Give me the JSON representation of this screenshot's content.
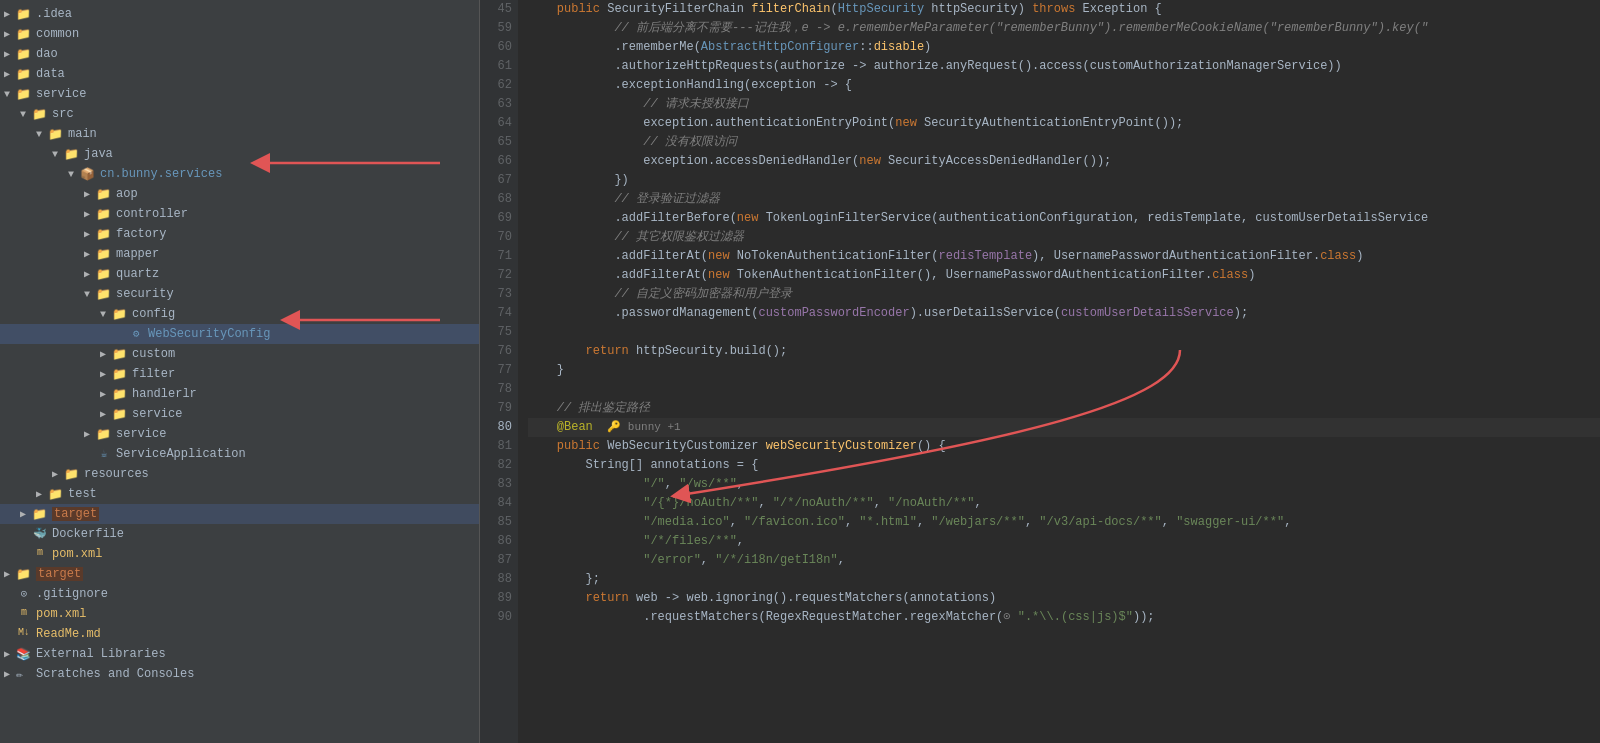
{
  "sidebar": {
    "items": [
      {
        "id": "idea",
        "label": ".idea",
        "level": 0,
        "type": "folder",
        "expanded": false,
        "arrow": "▶"
      },
      {
        "id": "common",
        "label": "common",
        "level": 0,
        "type": "folder",
        "expanded": false,
        "arrow": "▶"
      },
      {
        "id": "dao",
        "label": "dao",
        "level": 0,
        "type": "folder",
        "expanded": false,
        "arrow": "▶"
      },
      {
        "id": "data",
        "label": "data",
        "level": 0,
        "type": "folder",
        "expanded": false,
        "arrow": "▶"
      },
      {
        "id": "service",
        "label": "service",
        "level": 0,
        "type": "folder",
        "expanded": true,
        "arrow": "▼"
      },
      {
        "id": "src",
        "label": "src",
        "level": 1,
        "type": "folder",
        "expanded": true,
        "arrow": "▼"
      },
      {
        "id": "main",
        "label": "main",
        "level": 2,
        "type": "folder",
        "expanded": true,
        "arrow": "▼"
      },
      {
        "id": "java",
        "label": "java",
        "level": 3,
        "type": "folder-src",
        "expanded": true,
        "arrow": "▼"
      },
      {
        "id": "cn.bunny.services",
        "label": "cn.bunny.services",
        "level": 4,
        "type": "folder-pkg",
        "expanded": true,
        "arrow": "▼"
      },
      {
        "id": "aop",
        "label": "aop",
        "level": 5,
        "type": "folder",
        "expanded": false,
        "arrow": "▶"
      },
      {
        "id": "controller",
        "label": "controller",
        "level": 5,
        "type": "folder",
        "expanded": false,
        "arrow": "▶"
      },
      {
        "id": "factory",
        "label": "factory",
        "level": 5,
        "type": "folder",
        "expanded": false,
        "arrow": "▶"
      },
      {
        "id": "mapper",
        "label": "mapper",
        "level": 5,
        "type": "folder",
        "expanded": false,
        "arrow": "▶"
      },
      {
        "id": "quartz",
        "label": "quartz",
        "level": 5,
        "type": "folder",
        "expanded": false,
        "arrow": "▶"
      },
      {
        "id": "security",
        "label": "security",
        "level": 5,
        "type": "folder",
        "expanded": true,
        "arrow": "▼"
      },
      {
        "id": "config",
        "label": "config",
        "level": 6,
        "type": "folder",
        "expanded": true,
        "arrow": "▼"
      },
      {
        "id": "WebSecurityConfig",
        "label": "WebSecurityConfig",
        "level": 7,
        "type": "java-config",
        "arrow": ""
      },
      {
        "id": "custom",
        "label": "custom",
        "level": 6,
        "type": "folder",
        "expanded": false,
        "arrow": "▶"
      },
      {
        "id": "filter",
        "label": "filter",
        "level": 6,
        "type": "folder",
        "expanded": false,
        "arrow": "▶"
      },
      {
        "id": "handlerr",
        "label": "handlerr",
        "level": 6,
        "type": "folder",
        "expanded": false,
        "arrow": "▶"
      },
      {
        "id": "service-inner",
        "label": "service",
        "level": 6,
        "type": "folder",
        "expanded": false,
        "arrow": "▶"
      },
      {
        "id": "service2",
        "label": "service",
        "level": 5,
        "type": "folder",
        "expanded": false,
        "arrow": "▶"
      },
      {
        "id": "ServiceApplication",
        "label": "ServiceApplication",
        "level": 5,
        "type": "java-app",
        "arrow": ""
      },
      {
        "id": "resources",
        "label": "resources",
        "level": 3,
        "type": "folder",
        "expanded": false,
        "arrow": "▶"
      },
      {
        "id": "test",
        "label": "test",
        "level": 2,
        "type": "folder",
        "expanded": false,
        "arrow": "▶"
      },
      {
        "id": "target",
        "label": "target",
        "level": 1,
        "type": "folder-target",
        "expanded": false,
        "arrow": "▶"
      },
      {
        "id": "Dockerfile",
        "label": "Dockerfile",
        "level": 1,
        "type": "docker",
        "arrow": ""
      },
      {
        "id": "pom-service",
        "label": "pom.xml",
        "level": 1,
        "type": "xml",
        "arrow": ""
      },
      {
        "id": "target2",
        "label": "target",
        "level": 0,
        "type": "folder-target2",
        "expanded": false,
        "arrow": "▶"
      },
      {
        "id": "gitignore",
        "label": ".gitignore",
        "level": 0,
        "type": "file",
        "arrow": ""
      },
      {
        "id": "pom",
        "label": "pom.xml",
        "level": 0,
        "type": "xml",
        "arrow": ""
      },
      {
        "id": "ReadMe",
        "label": "ReadMe.md",
        "level": 0,
        "type": "md",
        "arrow": ""
      }
    ],
    "bottom_items": [
      {
        "id": "external-libs",
        "label": "External Libraries",
        "arrow": "▶"
      },
      {
        "id": "scratches",
        "label": "Scratches and Consoles",
        "arrow": "▶"
      }
    ]
  },
  "editor": {
    "lines": [
      {
        "num": 45,
        "tokens": [
          {
            "text": "    ",
            "cls": "plain"
          },
          {
            "text": "public",
            "cls": "kw"
          },
          {
            "text": " SecurityFilterChain ",
            "cls": "plain"
          },
          {
            "text": "filterChain",
            "cls": "fn"
          },
          {
            "text": "(",
            "cls": "plain"
          },
          {
            "text": "HttpSecurity",
            "cls": "type"
          },
          {
            "text": " httpSecurity) ",
            "cls": "plain"
          },
          {
            "text": "throws",
            "cls": "kw"
          },
          {
            "text": " Exception {",
            "cls": "plain"
          }
        ]
      },
      {
        "num": 59,
        "tokens": [
          {
            "text": "            // 前后端分离不需要---记住我，e -> e.rememberMeParameter(\"rememberBunny\").rememberMeCookieName(\"rememberBunny\").key(\"",
            "cls": "comment"
          }
        ]
      },
      {
        "num": 60,
        "tokens": [
          {
            "text": "            .rememberMe(",
            "cls": "plain"
          },
          {
            "text": "AbstractHttpConfigurer",
            "cls": "type"
          },
          {
            "text": "::",
            "cls": "plain"
          },
          {
            "text": "disable",
            "cls": "fn"
          },
          {
            "text": ")",
            "cls": "plain"
          }
        ]
      },
      {
        "num": 61,
        "tokens": [
          {
            "text": "            .authorizeHttpRequests(authorize -> authorize.anyRequest().access(",
            "cls": "plain"
          },
          {
            "text": "customAuthorizationManagerService",
            "cls": "plain"
          },
          {
            "text": "))",
            "cls": "plain"
          }
        ]
      },
      {
        "num": 62,
        "tokens": [
          {
            "text": "            .exceptionHandling(exception -> {",
            "cls": "plain"
          }
        ]
      },
      {
        "num": 63,
        "tokens": [
          {
            "text": "                // 请求未授权接口",
            "cls": "comment"
          }
        ]
      },
      {
        "num": 64,
        "tokens": [
          {
            "text": "                exception.authenticationEntryPoint(",
            "cls": "plain"
          },
          {
            "text": "new",
            "cls": "kw"
          },
          {
            "text": " SecurityAuthenticationEntryPoint());",
            "cls": "plain"
          }
        ]
      },
      {
        "num": 65,
        "tokens": [
          {
            "text": "                // 没有权限访问",
            "cls": "comment"
          }
        ]
      },
      {
        "num": 66,
        "tokens": [
          {
            "text": "                exception.accessDeniedHandler(",
            "cls": "plain"
          },
          {
            "text": "new",
            "cls": "kw"
          },
          {
            "text": " SecurityAccessDeniedHandler());",
            "cls": "plain"
          }
        ]
      },
      {
        "num": 67,
        "tokens": [
          {
            "text": "            })",
            "cls": "plain"
          }
        ]
      },
      {
        "num": 68,
        "tokens": [
          {
            "text": "            // 登录验证过滤器",
            "cls": "comment"
          }
        ]
      },
      {
        "num": 69,
        "tokens": [
          {
            "text": "            .addFilterBefore(",
            "cls": "plain"
          },
          {
            "text": "new",
            "cls": "kw"
          },
          {
            "text": " TokenLoginFilterService(authenticationConfiguration, redisTemplate, customUserDetailsService",
            "cls": "plain"
          }
        ]
      },
      {
        "num": 70,
        "tokens": [
          {
            "text": "            // 其它权限鉴权过滤器",
            "cls": "comment"
          }
        ]
      },
      {
        "num": 71,
        "tokens": [
          {
            "text": "            .addFilterAt(",
            "cls": "plain"
          },
          {
            "text": "new",
            "cls": "kw"
          },
          {
            "text": " NoTokenAuthenticationFilter(",
            "cls": "plain"
          },
          {
            "text": "redisTemplate",
            "cls": "plain"
          },
          {
            "text": "), UsernamePasswordAuthenticationFilter.",
            "cls": "plain"
          },
          {
            "text": "class",
            "cls": "kw"
          },
          {
            "text": ")",
            "cls": "plain"
          }
        ]
      },
      {
        "num": 72,
        "tokens": [
          {
            "text": "            .addFilterAt(",
            "cls": "plain"
          },
          {
            "text": "new",
            "cls": "kw"
          },
          {
            "text": " TokenAuthenticationFilter(), UsernamePasswordAuthenticationFilter.",
            "cls": "plain"
          },
          {
            "text": "class",
            "cls": "kw"
          },
          {
            "text": ")",
            "cls": "plain"
          }
        ]
      },
      {
        "num": 73,
        "tokens": [
          {
            "text": "            // 自定义密码加密器和用户登录",
            "cls": "comment"
          }
        ]
      },
      {
        "num": 74,
        "tokens": [
          {
            "text": "            .passwordManagement(",
            "cls": "plain"
          },
          {
            "text": "customPasswordEncoder",
            "cls": "plain"
          },
          {
            "text": ").userDetailsService(",
            "cls": "plain"
          },
          {
            "text": "customUserDetailsService",
            "cls": "plain"
          },
          {
            "text": ");",
            "cls": "plain"
          }
        ]
      },
      {
        "num": 75,
        "tokens": [
          {
            "text": "",
            "cls": "plain"
          }
        ]
      },
      {
        "num": 76,
        "tokens": [
          {
            "text": "        ",
            "cls": "plain"
          },
          {
            "text": "return",
            "cls": "kw"
          },
          {
            "text": " httpSecurity.build();",
            "cls": "plain"
          }
        ]
      },
      {
        "num": 77,
        "tokens": [
          {
            "text": "    }",
            "cls": "plain"
          }
        ]
      },
      {
        "num": 78,
        "tokens": [
          {
            "text": "",
            "cls": "plain"
          }
        ]
      },
      {
        "num": 79,
        "tokens": [
          {
            "text": "    // 排出鉴定路径",
            "cls": "comment"
          }
        ]
      },
      {
        "num": 80,
        "tokens": [
          {
            "text": "    ",
            "cls": "plain"
          },
          {
            "text": "@Bean",
            "cls": "annotation"
          },
          {
            "text": "  ",
            "cls": "plain"
          },
          {
            "text": "bunny",
            "cls": "plain"
          },
          {
            "text": " +1",
            "cls": "plain"
          }
        ]
      },
      {
        "num": 81,
        "tokens": [
          {
            "text": "    ",
            "cls": "plain"
          },
          {
            "text": "public",
            "cls": "kw"
          },
          {
            "text": " WebSecurityCustomizer ",
            "cls": "type"
          },
          {
            "text": "webSecurityCustomizer",
            "cls": "fn"
          },
          {
            "text": "() {",
            "cls": "plain"
          }
        ]
      },
      {
        "num": 82,
        "tokens": [
          {
            "text": "        String[] annotations = {",
            "cls": "plain"
          }
        ]
      },
      {
        "num": 83,
        "tokens": [
          {
            "text": "                ",
            "cls": "plain"
          },
          {
            "text": "\"/\"",
            "cls": "str"
          },
          {
            "text": ", ",
            "cls": "plain"
          },
          {
            "text": "\"/ws/**\"",
            "cls": "str"
          },
          {
            "text": ",",
            "cls": "plain"
          }
        ]
      },
      {
        "num": 84,
        "tokens": [
          {
            "text": "                ",
            "cls": "plain"
          },
          {
            "text": "\"/*/noAuth/**\"",
            "cls": "str"
          },
          {
            "text": ", ",
            "cls": "plain"
          },
          {
            "text": "\"/*/noAuth/**\"",
            "cls": "str"
          },
          {
            "text": ", ",
            "cls": "plain"
          },
          {
            "text": "\"/noAuth/**\"",
            "cls": "str"
          },
          {
            "text": ",",
            "cls": "plain"
          }
        ]
      },
      {
        "num": 85,
        "tokens": [
          {
            "text": "                ",
            "cls": "plain"
          },
          {
            "text": "\"/media.ico\"",
            "cls": "str"
          },
          {
            "text": ", ",
            "cls": "plain"
          },
          {
            "text": "\"/favicon.ico\"",
            "cls": "str"
          },
          {
            "text": ", ",
            "cls": "plain"
          },
          {
            "text": "\"*.html\"",
            "cls": "str"
          },
          {
            "text": ", ",
            "cls": "plain"
          },
          {
            "text": "\"/webjars/**\"",
            "cls": "str"
          },
          {
            "text": ", ",
            "cls": "plain"
          },
          {
            "text": "\"/v3/api-docs/**\"",
            "cls": "str"
          },
          {
            "text": ", ",
            "cls": "plain"
          },
          {
            "text": "\"swagger-ui/**\"",
            "cls": "str"
          },
          {
            "text": ",",
            "cls": "plain"
          }
        ]
      },
      {
        "num": 86,
        "tokens": [
          {
            "text": "                ",
            "cls": "plain"
          },
          {
            "text": "\"/*/files/**\"",
            "cls": "str"
          },
          {
            "text": ",",
            "cls": "plain"
          }
        ]
      },
      {
        "num": 87,
        "tokens": [
          {
            "text": "                ",
            "cls": "plain"
          },
          {
            "text": "\"/error\"",
            "cls": "str"
          },
          {
            "text": ", ",
            "cls": "plain"
          },
          {
            "text": "\"/*/i18n/getI18n\"",
            "cls": "str"
          },
          {
            "text": ",",
            "cls": "plain"
          }
        ]
      },
      {
        "num": 88,
        "tokens": [
          {
            "text": "        };",
            "cls": "plain"
          }
        ]
      },
      {
        "num": 89,
        "tokens": [
          {
            "text": "        ",
            "cls": "plain"
          },
          {
            "text": "return",
            "cls": "kw"
          },
          {
            "text": " web -> web.ignoring().requestMatchers(annotations)",
            "cls": "plain"
          }
        ]
      },
      {
        "num": 90,
        "tokens": [
          {
            "text": "                .requestMatchers(RegexRequestMatcher.regexMatcher(",
            "cls": "plain"
          },
          {
            "text": "⊙",
            "cls": "plain"
          },
          {
            "text": " ",
            "cls": "plain"
          },
          {
            "text": "\".*\\\\.(css|js)$\"",
            "cls": "str"
          },
          {
            "text": "));",
            "cls": "plain"
          }
        ]
      }
    ]
  },
  "bottom_bar": {
    "external_libs": "External Libraries",
    "scratches": "Scratches and Consoles"
  },
  "arrows": {
    "sidebar_arrow1": {
      "desc": "points to cn.bunny.services folder"
    },
    "sidebar_arrow2": {
      "desc": "points to WebSecurityConfig file"
    },
    "editor_arrow": {
      "desc": "points to line 80 bean annotation area"
    }
  }
}
